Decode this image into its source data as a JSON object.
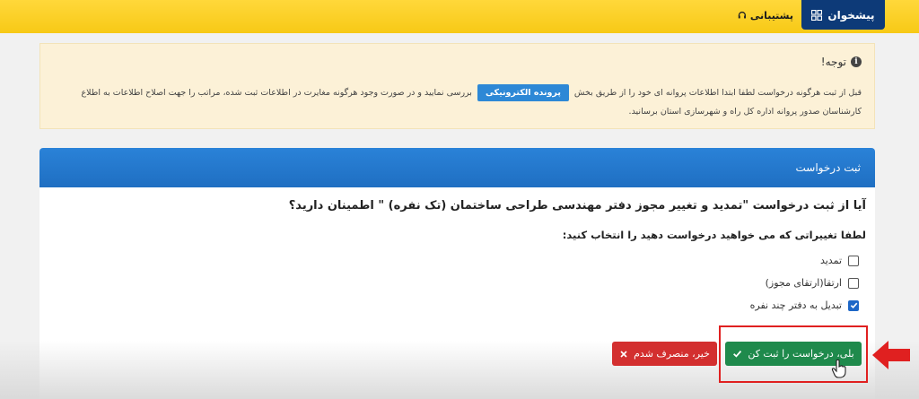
{
  "topbar": {
    "dashboard_label": "پیشخوان",
    "support_label": "پشتیبانی"
  },
  "notice": {
    "title": "توجه!",
    "line1_before": "قبل از ثبت هرگونه درخواست لطفا ابتدا اطلاعات پروانه ای خود را از طریق بخش",
    "efile_button": "پرونده الکترونیکی",
    "line1_after": "بررسی نمایید و در صورت وجود هرگونه مغایرت در اطلاعات ثبت شده، مراتب را جهت اصلاح اطلاعات به اطلاع",
    "line2": "کارشناسان صدور پروانه اداره کل راه و شهرسازی استان برسانید."
  },
  "panel": {
    "header": "ثبت درخواست",
    "question": "آیا از ثبت درخواست \"تمدید و تغییر مجوز دفتر مهندسی طراحی ساختمان (تک نفره) \" اطمینان دارید؟",
    "instruction": "لطفا تغییراتی که می خواهید درخواست دهید را انتخاب کنید:",
    "options": [
      {
        "label": "تمدید",
        "checked": false
      },
      {
        "label": "ارتقا(ارتقای مجوز)",
        "checked": false
      },
      {
        "label": "تبدیل به دفتر چند نفره",
        "checked": true
      }
    ]
  },
  "actions": {
    "confirm_label": "بلی، درخواست را ثبت کن",
    "cancel_label": "خیر، منصرف شدم"
  },
  "colors": {
    "topbar": "#f7c916",
    "dashboard_bg": "#0d3a78",
    "panel_header": "#2078cc",
    "confirm": "#1f8a4c",
    "cancel": "#d32f2f",
    "annotation": "#e02020"
  }
}
